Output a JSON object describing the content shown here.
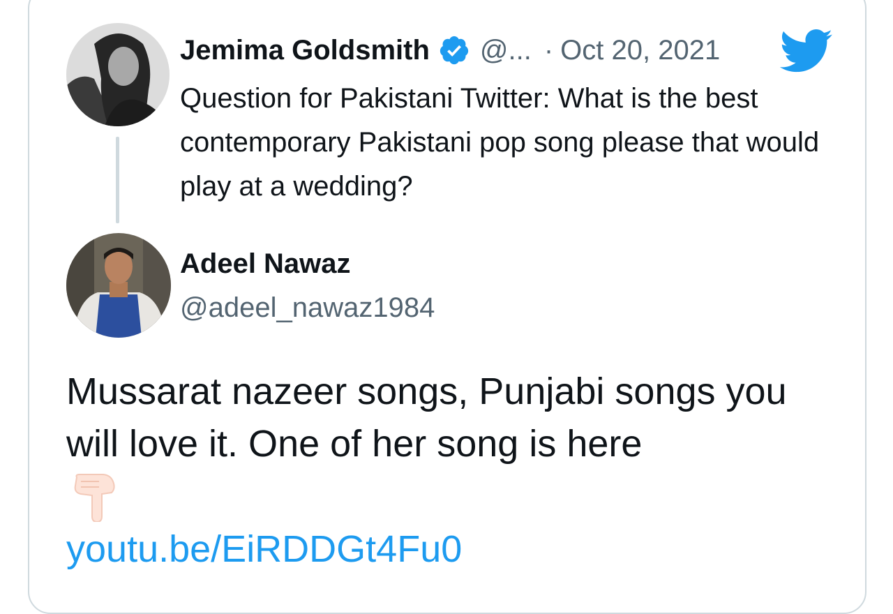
{
  "quoted_tweet": {
    "author_name": "Jemima Goldsmith",
    "handle": "@...",
    "separator": "·",
    "date": "Oct 20, 2021",
    "text": "Question for Pakistani Twitter: What is the best contemporary Pakistani pop song please that would play at a wedding?"
  },
  "reply": {
    "author_name": "Adeel Nawaz",
    "handle": "@adeel_nawaz1984",
    "text": "Mussarat nazeer songs, Punjabi songs you will love it. One of her song is here",
    "link_text": "youtu.be/EiRDDGt4Fu0"
  },
  "icons": {
    "verified": "verified-badge-icon",
    "brand": "twitter-bird-icon",
    "emoji": "backhand-index-pointing-down-icon"
  },
  "colors": {
    "brand_blue": "#1d9bf0",
    "text_primary": "#0f1419",
    "text_secondary": "#536471",
    "border": "#cfd9de"
  }
}
